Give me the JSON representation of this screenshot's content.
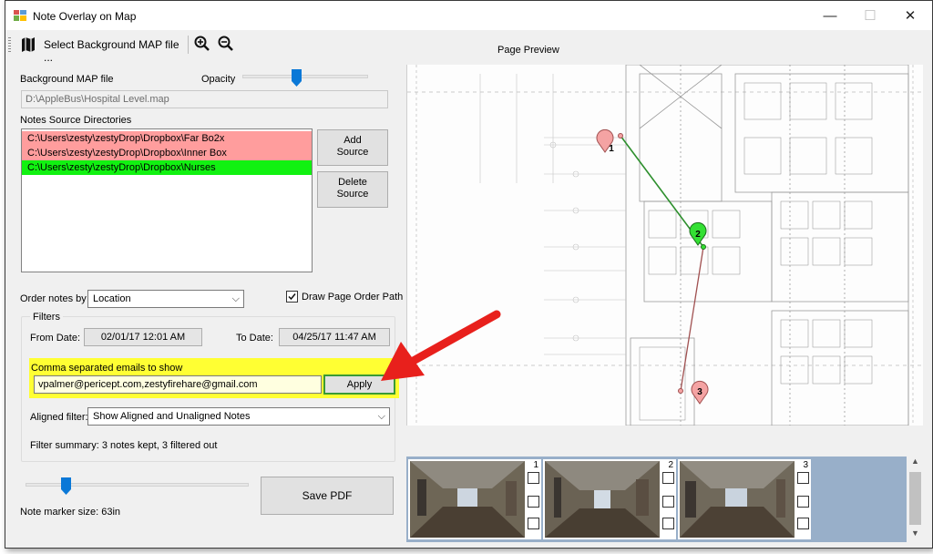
{
  "window": {
    "title": "Note Overlay on Map",
    "min_glyph": "—",
    "max_glyph": "☐",
    "close_glyph": "✕"
  },
  "toolbar": {
    "select_map_label": "Select Background MAP file ...",
    "zoom_in_icon": "zoom-in-icon",
    "zoom_out_icon": "zoom-out-icon"
  },
  "preview": {
    "title": "Page Preview"
  },
  "background_map": {
    "label": "Background MAP file",
    "opacity_label": "Opacity",
    "opacity_fraction": 0.6,
    "path": "D:\\AppleBus\\Hospital Level.map"
  },
  "notes_sources": {
    "label": "Notes Source Directories",
    "items": [
      {
        "path": "C:\\Users\\zesty\\zestyDrop\\Dropbox\\Far Bo2x",
        "color": "#ff9d9d"
      },
      {
        "path": "C:\\Users\\zesty\\zestyDrop\\Dropbox\\Inner Box",
        "color": "#ff9d9d"
      },
      {
        "path": "C:\\Users\\zesty\\zestyDrop\\Dropbox\\Nurses",
        "color": "#11f111"
      }
    ],
    "add_line1": "Add",
    "add_line2": "Source",
    "delete_line1": "Delete",
    "delete_line2": "Source"
  },
  "order": {
    "label": "Order notes by",
    "value": "Location",
    "draw_path_label": "Draw Page Order Path",
    "draw_path_checked": true
  },
  "filters": {
    "title": "Filters",
    "from_label": "From Date:",
    "from_value": "02/01/17 12:01 AM",
    "to_label": "To Date:",
    "to_value": "04/25/17 11:47 AM",
    "emails_label": "Comma separated emails to show",
    "emails_value": "vpalmer@pericept.com,zestyfirehare@gmail.com",
    "apply_label": "Apply",
    "aligned_label": "Aligned filter:",
    "aligned_value": "Show Aligned and Unaligned Notes",
    "summary": "Filter summary: 3 notes kept, 3 filtered out"
  },
  "marker": {
    "size_label": "Note marker size: 63in",
    "slider_fraction": 0.18
  },
  "save_pdf_label": "Save PDF",
  "map_markers": [
    {
      "label": "1",
      "color": "#f4a3a3"
    },
    {
      "label": "2",
      "color": "#33e033"
    },
    {
      "label": "3",
      "color": "#f4a3a3"
    }
  ],
  "thumbnails": [
    {
      "number": "1"
    },
    {
      "number": "2"
    },
    {
      "number": "3"
    }
  ],
  "colors": {
    "highlight": "#ffff33",
    "apply_border": "#3a9a35",
    "arrow": "#e8201c",
    "strip": "#98afc9"
  }
}
